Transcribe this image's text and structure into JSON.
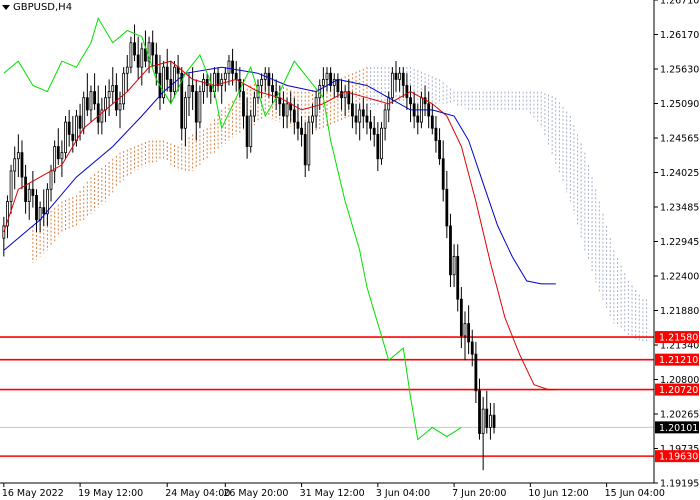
{
  "symbol": "GBPUSD,H4",
  "icons": {
    "menu": "triangle-down-icon"
  },
  "colors": {
    "background": "#ffffff",
    "candle": "#000000",
    "tenkan": "#e00000",
    "kijun": "#0000c8",
    "chikou": "#00e000",
    "kumo_a": "#d2691e",
    "kumo_b": "#9aa2c8",
    "level_line": "#ff0000",
    "current_price_bg": "#000000",
    "grid": "#c8c8c8"
  },
  "chart_data": {
    "type": "candlestick",
    "title": "GBPUSD,H4",
    "ylim": [
      1.1919,
      1.271
    ],
    "y_ticks": [
      "1.26710",
      "1.26170",
      "1.25630",
      "1.25090",
      "1.24565",
      "1.24025",
      "1.23485",
      "1.22945",
      "1.22400",
      "1.21880",
      "1.21340",
      "1.20800",
      "1.20265",
      "1.19735",
      "1.19195"
    ],
    "x_ticks": [
      {
        "label": "16 May 2022",
        "idx": 0
      },
      {
        "label": "19 May 12:00",
        "idx": 21
      },
      {
        "label": "24 May 04:00",
        "idx": 45
      },
      {
        "label": "26 May 20:00",
        "idx": 61
      },
      {
        "label": "31 May 12:00",
        "idx": 82
      },
      {
        "label": "3 Jun 04:00",
        "idx": 103
      },
      {
        "label": "7 Jun 20:00",
        "idx": 124
      },
      {
        "label": "10 Jun 12:00",
        "idx": 145
      },
      {
        "label": "15 Jun 04:00",
        "idx": 166
      }
    ],
    "levels": [
      {
        "label": "1.21580",
        "value": 1.2158
      },
      {
        "label": "1.21210",
        "value": 1.2121
      },
      {
        "label": "1.20720",
        "value": 1.2072
      },
      {
        "label": "1.19630",
        "value": 1.1963
      }
    ],
    "current_price": {
      "label": "1.20101",
      "value": 1.20101
    },
    "candles": [
      [
        1.232,
        1.2355,
        1.229,
        1.234
      ],
      [
        1.234,
        1.239,
        1.232,
        1.238
      ],
      [
        1.238,
        1.244,
        1.236,
        1.243
      ],
      [
        1.243,
        1.247,
        1.24,
        1.245
      ],
      [
        1.245,
        1.249,
        1.242,
        1.246
      ],
      [
        1.246,
        1.248,
        1.24,
        1.242
      ],
      [
        1.242,
        1.244,
        1.236,
        1.238
      ],
      [
        1.238,
        1.241,
        1.235,
        1.24
      ],
      [
        1.24,
        1.243,
        1.237,
        1.239
      ],
      [
        1.239,
        1.24,
        1.233,
        1.235
      ],
      [
        1.235,
        1.238,
        1.233,
        1.237
      ],
      [
        1.237,
        1.24,
        1.234,
        1.236
      ],
      [
        1.236,
        1.241,
        1.234,
        1.24
      ],
      [
        1.24,
        1.244,
        1.238,
        1.243
      ],
      [
        1.243,
        1.248,
        1.241,
        1.247
      ],
      [
        1.247,
        1.25,
        1.244,
        1.245
      ],
      [
        1.245,
        1.248,
        1.242,
        1.246
      ],
      [
        1.246,
        1.252,
        1.245,
        1.251
      ],
      [
        1.251,
        1.253,
        1.247,
        1.249
      ],
      [
        1.249,
        1.252,
        1.246,
        1.248
      ],
      [
        1.248,
        1.253,
        1.247,
        1.252
      ],
      [
        1.252,
        1.254,
        1.248,
        1.25
      ],
      [
        1.25,
        1.256,
        1.249,
        1.255
      ],
      [
        1.255,
        1.259,
        1.252,
        1.253
      ],
      [
        1.253,
        1.257,
        1.251,
        1.256
      ],
      [
        1.256,
        1.259,
        1.253,
        1.254
      ],
      [
        1.254,
        1.257,
        1.249,
        1.251
      ],
      [
        1.251,
        1.255,
        1.249,
        1.253
      ],
      [
        1.253,
        1.257,
        1.251,
        1.255
      ],
      [
        1.255,
        1.258,
        1.252,
        1.256
      ],
      [
        1.256,
        1.26,
        1.254,
        1.257
      ],
      [
        1.257,
        1.259,
        1.252,
        1.253
      ],
      [
        1.253,
        1.256,
        1.25,
        1.254
      ],
      [
        1.254,
        1.26,
        1.253,
        1.259
      ],
      [
        1.259,
        1.262,
        1.256,
        1.26
      ],
      [
        1.26,
        1.265,
        1.259,
        1.264
      ],
      [
        1.264,
        1.267,
        1.261,
        1.262
      ],
      [
        1.262,
        1.265,
        1.258,
        1.26
      ],
      [
        1.26,
        1.264,
        1.257,
        1.263
      ],
      [
        1.263,
        1.266,
        1.26,
        1.261
      ],
      [
        1.261,
        1.265,
        1.259,
        1.264
      ],
      [
        1.264,
        1.266,
        1.26,
        1.262
      ],
      [
        1.262,
        1.264,
        1.257,
        1.259
      ],
      [
        1.259,
        1.262,
        1.253,
        1.255
      ],
      [
        1.255,
        1.261,
        1.254,
        1.26
      ],
      [
        1.26,
        1.263,
        1.256,
        1.258
      ],
      [
        1.258,
        1.261,
        1.254,
        1.256
      ],
      [
        1.256,
        1.261,
        1.255,
        1.26
      ],
      [
        1.26,
        1.262,
        1.256,
        1.259
      ],
      [
        1.259,
        1.26,
        1.248,
        1.25
      ],
      [
        1.25,
        1.256,
        1.247,
        1.255
      ],
      [
        1.255,
        1.259,
        1.252,
        1.257
      ],
      [
        1.257,
        1.26,
        1.253,
        1.256
      ],
      [
        1.256,
        1.258,
        1.248,
        1.251
      ],
      [
        1.251,
        1.257,
        1.25,
        1.256
      ],
      [
        1.256,
        1.259,
        1.254,
        1.258
      ],
      [
        1.258,
        1.259,
        1.255,
        1.257
      ],
      [
        1.257,
        1.259,
        1.254,
        1.256
      ],
      [
        1.256,
        1.26,
        1.255,
        1.259
      ],
      [
        1.259,
        1.26,
        1.256,
        1.257
      ],
      [
        1.257,
        1.259,
        1.254,
        1.258
      ],
      [
        1.258,
        1.26,
        1.256,
        1.259
      ],
      [
        1.259,
        1.262,
        1.257,
        1.261
      ],
      [
        1.261,
        1.263,
        1.257,
        1.259
      ],
      [
        1.259,
        1.261,
        1.256,
        1.258
      ],
      [
        1.258,
        1.26,
        1.255,
        1.256
      ],
      [
        1.256,
        1.258,
        1.25,
        1.252
      ],
      [
        1.252,
        1.255,
        1.245,
        1.247
      ],
      [
        1.247,
        1.253,
        1.246,
        1.252
      ],
      [
        1.252,
        1.256,
        1.251,
        1.255
      ],
      [
        1.255,
        1.258,
        1.254,
        1.257
      ],
      [
        1.257,
        1.259,
        1.255,
        1.258
      ],
      [
        1.258,
        1.26,
        1.256,
        1.259
      ],
      [
        1.259,
        1.26,
        1.255,
        1.257
      ],
      [
        1.257,
        1.259,
        1.254,
        1.256
      ],
      [
        1.256,
        1.258,
        1.253,
        1.255
      ],
      [
        1.255,
        1.257,
        1.252,
        1.254
      ],
      [
        1.254,
        1.256,
        1.25,
        1.252
      ],
      [
        1.252,
        1.255,
        1.25,
        1.254
      ],
      [
        1.254,
        1.256,
        1.251,
        1.253
      ],
      [
        1.253,
        1.255,
        1.249,
        1.251
      ],
      [
        1.251,
        1.254,
        1.248,
        1.25
      ],
      [
        1.25,
        1.252,
        1.247,
        1.249
      ],
      [
        1.249,
        1.251,
        1.242,
        1.244
      ],
      [
        1.244,
        1.252,
        1.243,
        1.251
      ],
      [
        1.251,
        1.254,
        1.249,
        1.252
      ],
      [
        1.252,
        1.256,
        1.25,
        1.255
      ],
      [
        1.255,
        1.258,
        1.253,
        1.257
      ],
      [
        1.257,
        1.26,
        1.255,
        1.258
      ],
      [
        1.258,
        1.26,
        1.256,
        1.259
      ],
      [
        1.259,
        1.26,
        1.256,
        1.257
      ],
      [
        1.257,
        1.259,
        1.255,
        1.258
      ],
      [
        1.258,
        1.259,
        1.255,
        1.256
      ],
      [
        1.256,
        1.258,
        1.253,
        1.255
      ],
      [
        1.255,
        1.257,
        1.252,
        1.256
      ],
      [
        1.256,
        1.258,
        1.253,
        1.254
      ],
      [
        1.254,
        1.256,
        1.25,
        1.252
      ],
      [
        1.252,
        1.254,
        1.249,
        1.251
      ],
      [
        1.251,
        1.254,
        1.248,
        1.253
      ],
      [
        1.253,
        1.255,
        1.25,
        1.252
      ],
      [
        1.252,
        1.254,
        1.249,
        1.251
      ],
      [
        1.251,
        1.253,
        1.248,
        1.25
      ],
      [
        1.25,
        1.252,
        1.247,
        1.249
      ],
      [
        1.249,
        1.251,
        1.243,
        1.245
      ],
      [
        1.245,
        1.251,
        1.244,
        1.25
      ],
      [
        1.25,
        1.254,
        1.248,
        1.253
      ],
      [
        1.253,
        1.256,
        1.251,
        1.255
      ],
      [
        1.255,
        1.26,
        1.254,
        1.259
      ],
      [
        1.259,
        1.261,
        1.256,
        1.258
      ],
      [
        1.258,
        1.26,
        1.256,
        1.259
      ],
      [
        1.259,
        1.26,
        1.255,
        1.257
      ],
      [
        1.257,
        1.259,
        1.253,
        1.255
      ],
      [
        1.255,
        1.257,
        1.251,
        1.254
      ],
      [
        1.254,
        1.256,
        1.25,
        1.252
      ],
      [
        1.252,
        1.254,
        1.249,
        1.251
      ],
      [
        1.251,
        1.256,
        1.25,
        1.255
      ],
      [
        1.255,
        1.257,
        1.252,
        1.254
      ],
      [
        1.254,
        1.256,
        1.25,
        1.252
      ],
      [
        1.252,
        1.254,
        1.249,
        1.25
      ],
      [
        1.25,
        1.252,
        1.246,
        1.248
      ],
      [
        1.248,
        1.25,
        1.244,
        1.245
      ],
      [
        1.245,
        1.248,
        1.238,
        1.24
      ],
      [
        1.24,
        1.243,
        1.232,
        1.234
      ],
      [
        1.234,
        1.236,
        1.224,
        1.226
      ],
      [
        1.226,
        1.231,
        1.224,
        1.229
      ],
      [
        1.229,
        1.231,
        1.22,
        1.222
      ],
      [
        1.222,
        1.224,
        1.214,
        1.216
      ],
      [
        1.216,
        1.22,
        1.212,
        1.218
      ],
      [
        1.218,
        1.221,
        1.213,
        1.215
      ],
      [
        1.215,
        1.217,
        1.211,
        1.213
      ],
      [
        1.213,
        1.215,
        1.205,
        1.207
      ],
      [
        1.207,
        1.209,
        1.199,
        1.2
      ],
      [
        1.2,
        1.206,
        1.194,
        1.204
      ],
      [
        1.204,
        1.207,
        1.2,
        1.201
      ],
      [
        1.201,
        1.205,
        1.199,
        1.203
      ],
      [
        1.203,
        1.205,
        1.2,
        1.201
      ]
    ],
    "tenkan": [
      [
        0,
        1.233
      ],
      [
        4,
        1.24
      ],
      [
        10,
        1.242
      ],
      [
        16,
        1.244
      ],
      [
        22,
        1.25
      ],
      [
        28,
        1.253
      ],
      [
        34,
        1.256
      ],
      [
        40,
        1.26
      ],
      [
        46,
        1.261
      ],
      [
        52,
        1.258
      ],
      [
        58,
        1.257
      ],
      [
        64,
        1.258
      ],
      [
        70,
        1.256
      ],
      [
        76,
        1.255
      ],
      [
        82,
        1.253
      ],
      [
        88,
        1.254
      ],
      [
        94,
        1.256
      ],
      [
        100,
        1.255
      ],
      [
        106,
        1.254
      ],
      [
        112,
        1.256
      ],
      [
        118,
        1.254
      ],
      [
        122,
        1.252
      ],
      [
        126,
        1.247
      ],
      [
        130,
        1.238
      ],
      [
        134,
        1.228
      ],
      [
        138,
        1.219
      ],
      [
        142,
        1.213
      ],
      [
        146,
        1.208
      ],
      [
        150,
        1.2072
      ],
      [
        152,
        1.2072
      ]
    ],
    "kijun": [
      [
        0,
        1.23
      ],
      [
        10,
        1.235
      ],
      [
        20,
        1.242
      ],
      [
        30,
        1.247
      ],
      [
        38,
        1.252
      ],
      [
        44,
        1.256
      ],
      [
        50,
        1.259
      ],
      [
        60,
        1.26
      ],
      [
        70,
        1.259
      ],
      [
        78,
        1.257
      ],
      [
        86,
        1.256
      ],
      [
        92,
        1.258
      ],
      [
        100,
        1.257
      ],
      [
        106,
        1.255
      ],
      [
        112,
        1.253
      ],
      [
        118,
        1.253
      ],
      [
        124,
        1.252
      ],
      [
        128,
        1.248
      ],
      [
        132,
        1.241
      ],
      [
        136,
        1.234
      ],
      [
        140,
        1.229
      ],
      [
        144,
        1.225
      ],
      [
        148,
        1.2245
      ],
      [
        152,
        1.2245
      ]
    ],
    "chikou": [
      [
        0,
        1.259
      ],
      [
        4,
        1.261
      ],
      [
        8,
        1.257
      ],
      [
        12,
        1.256
      ],
      [
        16,
        1.261
      ],
      [
        20,
        1.26
      ],
      [
        24,
        1.264
      ],
      [
        26,
        1.268
      ],
      [
        30,
        1.264
      ],
      [
        34,
        1.266
      ],
      [
        38,
        1.265
      ],
      [
        42,
        1.258
      ],
      [
        46,
        1.254
      ],
      [
        50,
        1.259
      ],
      [
        54,
        1.262
      ],
      [
        58,
        1.256
      ],
      [
        60,
        1.25
      ],
      [
        64,
        1.255
      ],
      [
        68,
        1.26
      ],
      [
        72,
        1.252
      ],
      [
        76,
        1.256
      ],
      [
        80,
        1.261
      ],
      [
        84,
        1.258
      ],
      [
        88,
        1.255
      ],
      [
        90,
        1.248
      ],
      [
        94,
        1.238
      ],
      [
        98,
        1.23
      ],
      [
        100,
        1.224
      ],
      [
        104,
        1.216
      ],
      [
        106,
        1.212
      ],
      [
        110,
        1.214
      ],
      [
        112,
        1.206
      ],
      [
        114,
        1.199
      ],
      [
        118,
        1.201
      ],
      [
        122,
        1.1995
      ],
      [
        126,
        1.201
      ]
    ],
    "kumo": [
      [
        8,
        1.228,
        1.234
      ],
      [
        12,
        1.23,
        1.236
      ],
      [
        16,
        1.233,
        1.238
      ],
      [
        20,
        1.234,
        1.239
      ],
      [
        24,
        1.236,
        1.242
      ],
      [
        28,
        1.238,
        1.244
      ],
      [
        32,
        1.241,
        1.246
      ],
      [
        36,
        1.243,
        1.247
      ],
      [
        40,
        1.244,
        1.248
      ],
      [
        44,
        1.245,
        1.248
      ],
      [
        48,
        1.243,
        1.247
      ],
      [
        52,
        1.243,
        1.249
      ],
      [
        56,
        1.245,
        1.25
      ],
      [
        60,
        1.247,
        1.253
      ],
      [
        64,
        1.249,
        1.255
      ],
      [
        68,
        1.25,
        1.257
      ],
      [
        72,
        1.252,
        1.258
      ],
      [
        76,
        1.251,
        1.257
      ],
      [
        80,
        1.25,
        1.256
      ],
      [
        84,
        1.249,
        1.256
      ],
      [
        88,
        1.25,
        1.257
      ],
      [
        92,
        1.251,
        1.258
      ],
      [
        96,
        1.252,
        1.259
      ],
      [
        100,
        1.253,
        1.26
      ],
      [
        104,
        1.254,
        1.26
      ],
      [
        108,
        1.254,
        1.26
      ],
      [
        112,
        1.254,
        1.26
      ],
      [
        116,
        1.254,
        1.259
      ],
      [
        120,
        1.254,
        1.258
      ],
      [
        124,
        1.254,
        1.256
      ],
      [
        128,
        1.253,
        1.256
      ],
      [
        132,
        1.253,
        1.256
      ],
      [
        136,
        1.253,
        1.256
      ],
      [
        140,
        1.253,
        1.256
      ],
      [
        144,
        1.253,
        1.256
      ],
      [
        148,
        1.25,
        1.256
      ],
      [
        152,
        1.244,
        1.255
      ],
      [
        156,
        1.238,
        1.252
      ],
      [
        160,
        1.23,
        1.246
      ],
      [
        164,
        1.223,
        1.238
      ],
      [
        168,
        1.218,
        1.23
      ],
      [
        172,
        1.216,
        1.225
      ],
      [
        176,
        1.215,
        1.222
      ],
      [
        178,
        1.215,
        1.222
      ]
    ]
  }
}
